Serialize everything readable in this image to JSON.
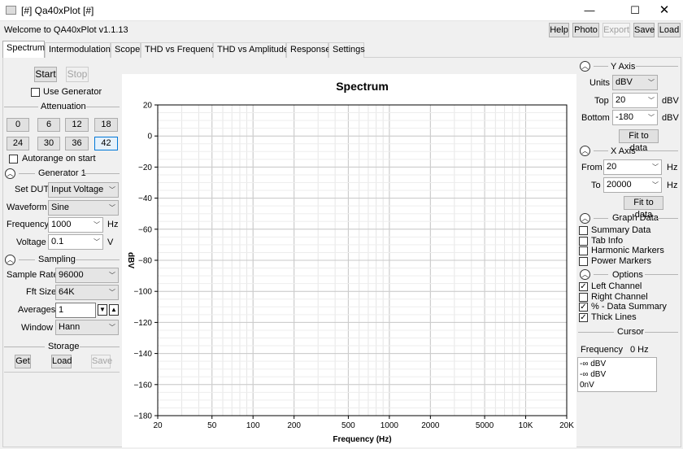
{
  "window": {
    "title": "[#] Qa40xPlot [#]",
    "minimize": "—",
    "maximize": "☐",
    "close": "✕"
  },
  "toolbar": {
    "welcome": "Welcome to QA40xPlot v1.1.13",
    "help": "Help",
    "photo": "Photo",
    "export": "Export",
    "save": "Save",
    "load": "Load"
  },
  "tabs": [
    "Spectrum",
    "Intermodulation",
    "Scope",
    "THD vs Frequency",
    "THD vs Amplitude",
    "Response",
    "Settings"
  ],
  "left": {
    "start": "Start",
    "stop": "Stop",
    "use_generator": "Use Generator",
    "attenuation_header": "Attenuation",
    "attenuation_values": [
      "0",
      "6",
      "12",
      "18",
      "24",
      "30",
      "36",
      "42"
    ],
    "attenuation_selected": "42",
    "autorange": "Autorange on start",
    "generator_header": "Generator 1",
    "set_dut_label": "Set DUT",
    "set_dut_value": "Input Voltage",
    "waveform_label": "Waveform",
    "waveform_value": "Sine",
    "frequency_label": "Frequency",
    "frequency_value": "1000",
    "frequency_unit": "Hz",
    "voltage_label": "Voltage",
    "voltage_value": "0.1",
    "voltage_unit": "V",
    "sampling_header": "Sampling",
    "sample_rate_label": "Sample Rate",
    "sample_rate_value": "96000",
    "fft_size_label": "Fft Size",
    "fft_size_value": "64K",
    "averages_label": "Averages",
    "averages_value": "1",
    "window_label": "Window",
    "window_value": "Hann",
    "storage_header": "Storage",
    "get": "Get",
    "load": "Load",
    "save": "Save"
  },
  "right": {
    "y_axis_header": "Y Axis",
    "units_label": "Units",
    "units_value": "dBV",
    "top_label": "Top",
    "top_value": "20",
    "top_unit": "dBV",
    "bottom_label": "Bottom",
    "bottom_value": "-180",
    "bottom_unit": "dBV",
    "fit_to_data": "Fit to data",
    "x_axis_header": "X Axis",
    "from_label": "From",
    "from_value": "20",
    "from_unit": "Hz",
    "to_label": "To",
    "to_value": "20000",
    "to_unit": "Hz",
    "graph_data_header": "Graph Data",
    "graph_data_items": [
      {
        "label": "Summary Data",
        "checked": false
      },
      {
        "label": "Tab Info",
        "checked": false
      },
      {
        "label": "Harmonic Markers",
        "checked": false
      },
      {
        "label": "Power Markers",
        "checked": false
      }
    ],
    "options_header": "Options",
    "options_items": [
      {
        "label": "Left Channel",
        "checked": true
      },
      {
        "label": "Right Channel",
        "checked": false
      },
      {
        "label": "% - Data Summary",
        "checked": true
      },
      {
        "label": "Thick Lines",
        "checked": true
      }
    ],
    "cursor_header": "Cursor",
    "cursor_frequency_label": "Frequency",
    "cursor_frequency_value": "0 Hz",
    "cursor_lines": [
      "-∞ dBV",
      "-∞ dBV",
      "0nV"
    ]
  },
  "chart_data": {
    "type": "line",
    "title": "Spectrum",
    "xlabel": "Frequency (Hz)",
    "ylabel": "dBV",
    "x_scale": "log",
    "xlim": [
      20,
      20000
    ],
    "ylim": [
      -180,
      20
    ],
    "x_ticks": [
      20,
      50,
      100,
      200,
      500,
      1000,
      2000,
      5000,
      10000,
      20000
    ],
    "x_tick_labels": [
      "20",
      "50",
      "100",
      "200",
      "500",
      "1000",
      "2000",
      "5000",
      "10K",
      "20K"
    ],
    "y_ticks": [
      20,
      0,
      -20,
      -40,
      -60,
      -80,
      -100,
      -120,
      -140,
      -160,
      -180
    ],
    "y_tick_labels": [
      "20",
      "0",
      "−20",
      "−40",
      "−60",
      "−80",
      "−100",
      "−120",
      "−140",
      "−160",
      "−180"
    ],
    "grid": true,
    "series": []
  }
}
